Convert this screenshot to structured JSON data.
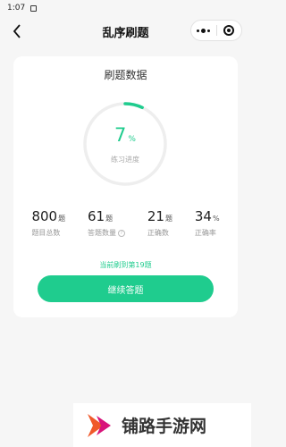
{
  "status_bar": {
    "time": "1:07"
  },
  "nav": {
    "title": "乱序刷题"
  },
  "card": {
    "title": "刷题数据",
    "progress": {
      "value": "7",
      "unit": "%",
      "label": "练习进度",
      "fraction": 0.07
    },
    "stats": [
      {
        "value": "800",
        "unit": "题",
        "label": "题目总数"
      },
      {
        "value": "61",
        "unit": "题",
        "label": "答题数量"
      },
      {
        "value": "21",
        "unit": "题",
        "label": "正确数"
      },
      {
        "value": "34",
        "unit": "%",
        "label": "正确率"
      }
    ],
    "current_text": "当前刷到第19题",
    "continue_label": "继续答题"
  },
  "colors": {
    "accent": "#1fcc8e",
    "track": "#eeeeee",
    "background": "#f6f6f6"
  },
  "icons": [
    "back-icon",
    "more-dots-icon",
    "close-target-icon",
    "help-icon",
    "watermark-logo"
  ],
  "watermark": {
    "text": "铺路手游网"
  }
}
